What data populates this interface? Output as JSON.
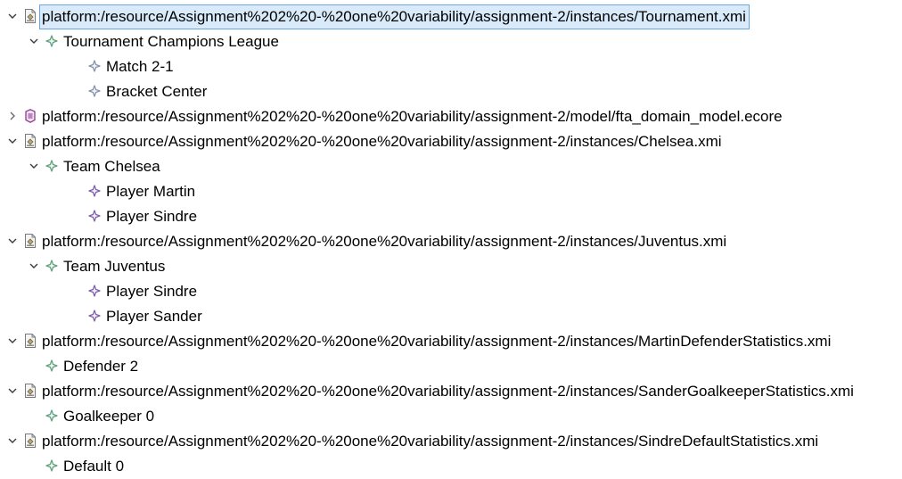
{
  "colors": {
    "selection_bg": "#d9ebfa",
    "selection_border": "#6aa7e0",
    "class_icon": "#5a9e7a",
    "attribute_icon": "#7a5aa6",
    "feature_icon": "#8090a8",
    "ecore_icon": "#8a2d8a"
  },
  "tree": {
    "nodes": [
      {
        "id": "n1",
        "depth": 0,
        "expander": "expanded",
        "icon": "xmi-resource-icon",
        "label": "platform:/resource/Assignment%202%20-%20one%20variability/assignment-2/instances/Tournament.xmi",
        "selected": true
      },
      {
        "id": "n2",
        "depth": 1,
        "expander": "expanded",
        "icon": "tournament-icon",
        "label": "Tournament Champions League"
      },
      {
        "id": "n3",
        "depth": 2,
        "expander": "none",
        "icon": "match-icon",
        "label": "Match 2-1"
      },
      {
        "id": "n4",
        "depth": 2,
        "expander": "none",
        "icon": "bracket-icon",
        "label": "Bracket Center"
      },
      {
        "id": "n5",
        "depth": 0,
        "expander": "collapsed",
        "icon": "ecore-resource-icon",
        "label": "platform:/resource/Assignment%202%20-%20one%20variability/assignment-2/model/fta_domain_model.ecore"
      },
      {
        "id": "n6",
        "depth": 0,
        "expander": "expanded",
        "icon": "xmi-resource-icon",
        "label": "platform:/resource/Assignment%202%20-%20one%20variability/assignment-2/instances/Chelsea.xmi"
      },
      {
        "id": "n7",
        "depth": 1,
        "expander": "expanded",
        "icon": "team-icon",
        "label": "Team Chelsea"
      },
      {
        "id": "n8",
        "depth": 2,
        "expander": "none",
        "icon": "player-icon",
        "label": "Player Martin"
      },
      {
        "id": "n9",
        "depth": 2,
        "expander": "none",
        "icon": "player-icon",
        "label": "Player Sindre"
      },
      {
        "id": "n10",
        "depth": 0,
        "expander": "expanded",
        "icon": "xmi-resource-icon",
        "label": "platform:/resource/Assignment%202%20-%20one%20variability/assignment-2/instances/Juventus.xmi"
      },
      {
        "id": "n11",
        "depth": 1,
        "expander": "expanded",
        "icon": "team-icon",
        "label": "Team Juventus"
      },
      {
        "id": "n12",
        "depth": 2,
        "expander": "none",
        "icon": "player-icon",
        "label": "Player Sindre"
      },
      {
        "id": "n13",
        "depth": 2,
        "expander": "none",
        "icon": "player-icon",
        "label": "Player Sander"
      },
      {
        "id": "n14",
        "depth": 0,
        "expander": "expanded",
        "icon": "xmi-resource-icon",
        "label": "platform:/resource/Assignment%202%20-%20one%20variability/assignment-2/instances/MartinDefenderStatistics.xmi"
      },
      {
        "id": "n15",
        "depth": 1,
        "expander": "none",
        "icon": "statistics-icon",
        "label": "Defender 2"
      },
      {
        "id": "n16",
        "depth": 0,
        "expander": "expanded",
        "icon": "xmi-resource-icon",
        "label": "platform:/resource/Assignment%202%20-%20one%20variability/assignment-2/instances/SanderGoalkeeperStatistics.xmi"
      },
      {
        "id": "n17",
        "depth": 1,
        "expander": "none",
        "icon": "statistics-icon",
        "label": "Goalkeeper 0"
      },
      {
        "id": "n18",
        "depth": 0,
        "expander": "expanded",
        "icon": "xmi-resource-icon",
        "label": "platform:/resource/Assignment%202%20-%20one%20variability/assignment-2/instances/SindreDefaultStatistics.xmi"
      },
      {
        "id": "n19",
        "depth": 1,
        "expander": "none",
        "icon": "statistics-icon",
        "label": "Default 0"
      }
    ]
  }
}
